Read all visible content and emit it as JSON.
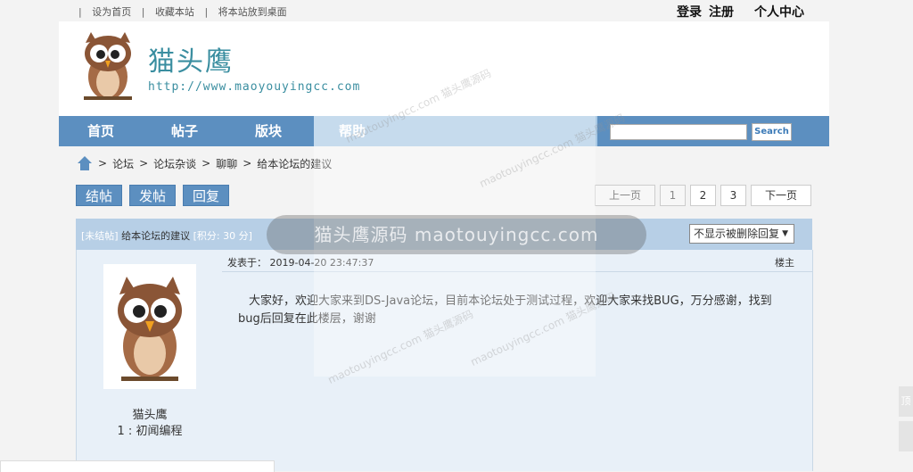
{
  "topbar": {
    "links": [
      "设为首页",
      "收藏本站",
      "将本站放到桌面"
    ],
    "login": "登录",
    "register": "注册",
    "user_center": "个人中心"
  },
  "header": {
    "title": "猫头鹰",
    "url": "http://www.maoyouyingcc.com"
  },
  "nav": {
    "items": [
      "首页",
      "帖子",
      "版块",
      "帮助"
    ],
    "search_button": "Search",
    "search_value": ""
  },
  "breadcrumb": [
    "论坛",
    "论坛杂谈",
    "聊聊",
    "给本论坛的建议"
  ],
  "actions": {
    "close": "结帖",
    "post": "发帖",
    "reply": "回复"
  },
  "pagination": {
    "prev": "上一页",
    "pages": [
      "1",
      "2",
      "3"
    ],
    "next": "下一页"
  },
  "thread": {
    "status": "[未结帖]",
    "title": "给本论坛的建议",
    "points": "[积分: 30 分]",
    "filter_selected": "不显示被删除回复"
  },
  "author": {
    "name": "猫头鹰",
    "level": "1 : 初闻编程"
  },
  "post": {
    "time": "发表于： 2019-04-20 23:47:37",
    "floor": "楼主",
    "content": "大家好，欢迎大家来到DS-Java论坛，目前本论坛处于测试过程，欢迎大家来找BUG，万分感谢，找到bug后回复在此楼层，谢谢"
  },
  "watermark": {
    "text": "猫头鹰源码 maotouyingcc.com",
    "small": "maotouyingcc.com 猫头鹰源码"
  },
  "side_buttons": [
    "顶",
    ""
  ],
  "colors": {
    "nav_bg": "#5c8fc0",
    "brand": "#3a8ea0",
    "thread_head": "#b7cfe6",
    "panel_bg": "#e8f0f8"
  }
}
